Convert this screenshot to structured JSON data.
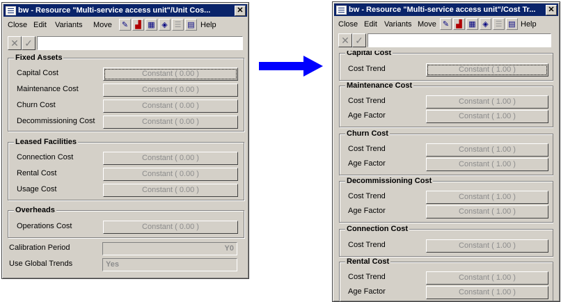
{
  "win1": {
    "title": "bw - Resource \"Multi-service access unit\"/Unit Cos...",
    "menus": [
      "Close",
      "Edit",
      "Variants",
      "Move",
      "Help"
    ],
    "groups": [
      {
        "title": "Fixed Assets",
        "rows": [
          {
            "label": "Capital Cost",
            "value": "Constant ( 0.00 )"
          },
          {
            "label": "Maintenance Cost",
            "value": "Constant ( 0.00 )"
          },
          {
            "label": "Churn Cost",
            "value": "Constant ( 0.00 )"
          },
          {
            "label": "Decommissioning Cost",
            "value": "Constant ( 0.00 )"
          }
        ]
      },
      {
        "title": "Leased Facilities",
        "rows": [
          {
            "label": "Connection Cost",
            "value": "Constant ( 0.00 )"
          },
          {
            "label": "Rental Cost",
            "value": "Constant ( 0.00 )"
          },
          {
            "label": "Usage Cost",
            "value": "Constant ( 0.00 )"
          }
        ]
      },
      {
        "title": "Overheads",
        "rows": [
          {
            "label": "Operations Cost",
            "value": "Constant ( 0.00 )"
          }
        ]
      }
    ],
    "calibration": {
      "label": "Calibration Period",
      "value": "Y0"
    },
    "global_trends": {
      "label": "Use Global Trends",
      "value": "Yes"
    }
  },
  "win2": {
    "title": "bw - Resource \"Multi-service access unit\"/Cost Tr...",
    "menus": [
      "Close",
      "Edit",
      "Variants",
      "Move",
      "Help"
    ],
    "groups": [
      {
        "title": "Capital Cost",
        "rows": [
          {
            "label": "Cost Trend",
            "value": "Constant ( 1.00 )"
          }
        ]
      },
      {
        "title": "Maintenance Cost",
        "rows": [
          {
            "label": "Cost Trend",
            "value": "Constant ( 1.00 )"
          },
          {
            "label": "Age Factor",
            "value": "Constant ( 1.00 )"
          }
        ]
      },
      {
        "title": "Churn Cost",
        "rows": [
          {
            "label": "Cost Trend",
            "value": "Constant ( 1.00 )"
          },
          {
            "label": "Age Factor",
            "value": "Constant ( 1.00 )"
          }
        ]
      },
      {
        "title": "Decommissioning Cost",
        "rows": [
          {
            "label": "Cost Trend",
            "value": "Constant ( 1.00 )"
          },
          {
            "label": "Age Factor",
            "value": "Constant ( 1.00 )"
          }
        ]
      },
      {
        "title": "Connection Cost",
        "rows": [
          {
            "label": "Cost Trend",
            "value": "Constant ( 1.00 )"
          }
        ]
      },
      {
        "title": "Rental Cost",
        "rows": [
          {
            "label": "Cost Trend",
            "value": "Constant ( 1.00 )"
          },
          {
            "label": "Age Factor",
            "value": "Constant ( 1.00 )"
          }
        ]
      }
    ]
  },
  "toolbar_icons": [
    "properties-icon",
    "chart-icon",
    "table-icon",
    "database-icon",
    "list-icon",
    "calculator-icon"
  ],
  "colors": {
    "titlebar": "#0a246a",
    "face": "#d4d0c8",
    "arrow": "#0000ff"
  }
}
